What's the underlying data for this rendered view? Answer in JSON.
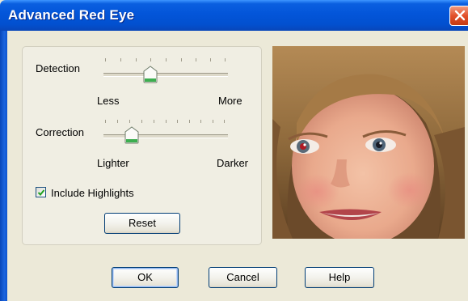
{
  "window": {
    "title": "Advanced Red Eye"
  },
  "detection": {
    "label": "Detection",
    "min_label": "Less",
    "max_label": "More",
    "value_percent": 38
  },
  "correction": {
    "label": "Correction",
    "min_label": "Lighter",
    "max_label": "Darker",
    "value_percent": 22
  },
  "include_highlights": {
    "label": "Include Highlights",
    "checked": true
  },
  "buttons": {
    "reset": "Reset",
    "ok": "OK",
    "cancel": "Cancel",
    "help": "Help"
  },
  "preview": {
    "image": "child-face-photo"
  },
  "colors": {
    "title_bar": "#0355d9",
    "dialog_bg": "#ece9d8",
    "close_button": "#e2502a",
    "slider_thumb": "#3cae4f"
  }
}
